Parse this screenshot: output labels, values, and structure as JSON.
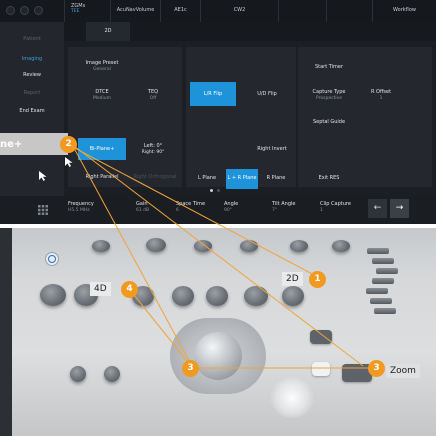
{
  "screen": {
    "top_bar": {
      "probe": "ZGMs",
      "probe_sub": "TEE",
      "tabs": [
        "AcuNavVolume",
        "AE1c",
        "CW2"
      ],
      "workflow_label": "Workflow"
    },
    "sidebar": {
      "items": [
        {
          "label": "Patient",
          "state": "dim"
        },
        {
          "label": "Imaging",
          "state": "active"
        },
        {
          "label": "Review",
          "state": "normal"
        },
        {
          "label": "Report",
          "state": "dim"
        },
        {
          "label": "End Exam",
          "state": "normal"
        }
      ]
    },
    "mode_tab": "2D",
    "buttons": {
      "image_preset": {
        "label": "Image Preset",
        "value": "General"
      },
      "dtce": {
        "label": "DTCE",
        "value": "Medium"
      },
      "tei": {
        "label": "TEQ",
        "value": "Off"
      },
      "lr_flip": "L/R Flip",
      "ud_flip": "U/D Flip",
      "start_timer": "Start Timer",
      "capture_type": {
        "label": "Capture Type",
        "value": "Prospective"
      },
      "r_offset": {
        "label": "R Offset",
        "value": "1"
      },
      "septal_guide": "Septal Guide",
      "biplane": "Bi-Plane+",
      "left_right": {
        "label": "Left: 0°",
        "value": "Right: 90°"
      },
      "right_invert": "Right Invert",
      "right_parallel": "Right Parallel",
      "right_orthogonal": "Right Orthogonal",
      "l_plane": "L Plane",
      "lr_plane": "L + R Plane",
      "r_plane": "R Plane",
      "exit_res": "Exit RES"
    },
    "bottom_bar": {
      "frequency": {
        "label": "Frequency",
        "value": "H5.5 MHz"
      },
      "gain": {
        "label": "Gain",
        "value": "61 dB"
      },
      "space_time": {
        "label": "Space Time",
        "value": "6"
      },
      "angle": {
        "label": "Angle",
        "value": "90°"
      },
      "tilt_angle": {
        "label": "Tilt Angle",
        "value": "7°"
      },
      "clip_capture": {
        "label": "Clip Capture",
        "value": "1"
      },
      "back_arrow": "←",
      "next_arrow": "→"
    },
    "callout_text": "ne+"
  },
  "console": {
    "labels": {
      "four_d": "4D",
      "two_d": "2D",
      "zoom": "Zoom"
    }
  },
  "badges": {
    "n1": "1",
    "n2": "2",
    "n3a": "3",
    "n3b": "3",
    "n4": "4"
  },
  "colors": {
    "accent_blue": "#1f93d9",
    "badge_orange": "#f29a1f",
    "line_orange": "#f0a43a"
  }
}
